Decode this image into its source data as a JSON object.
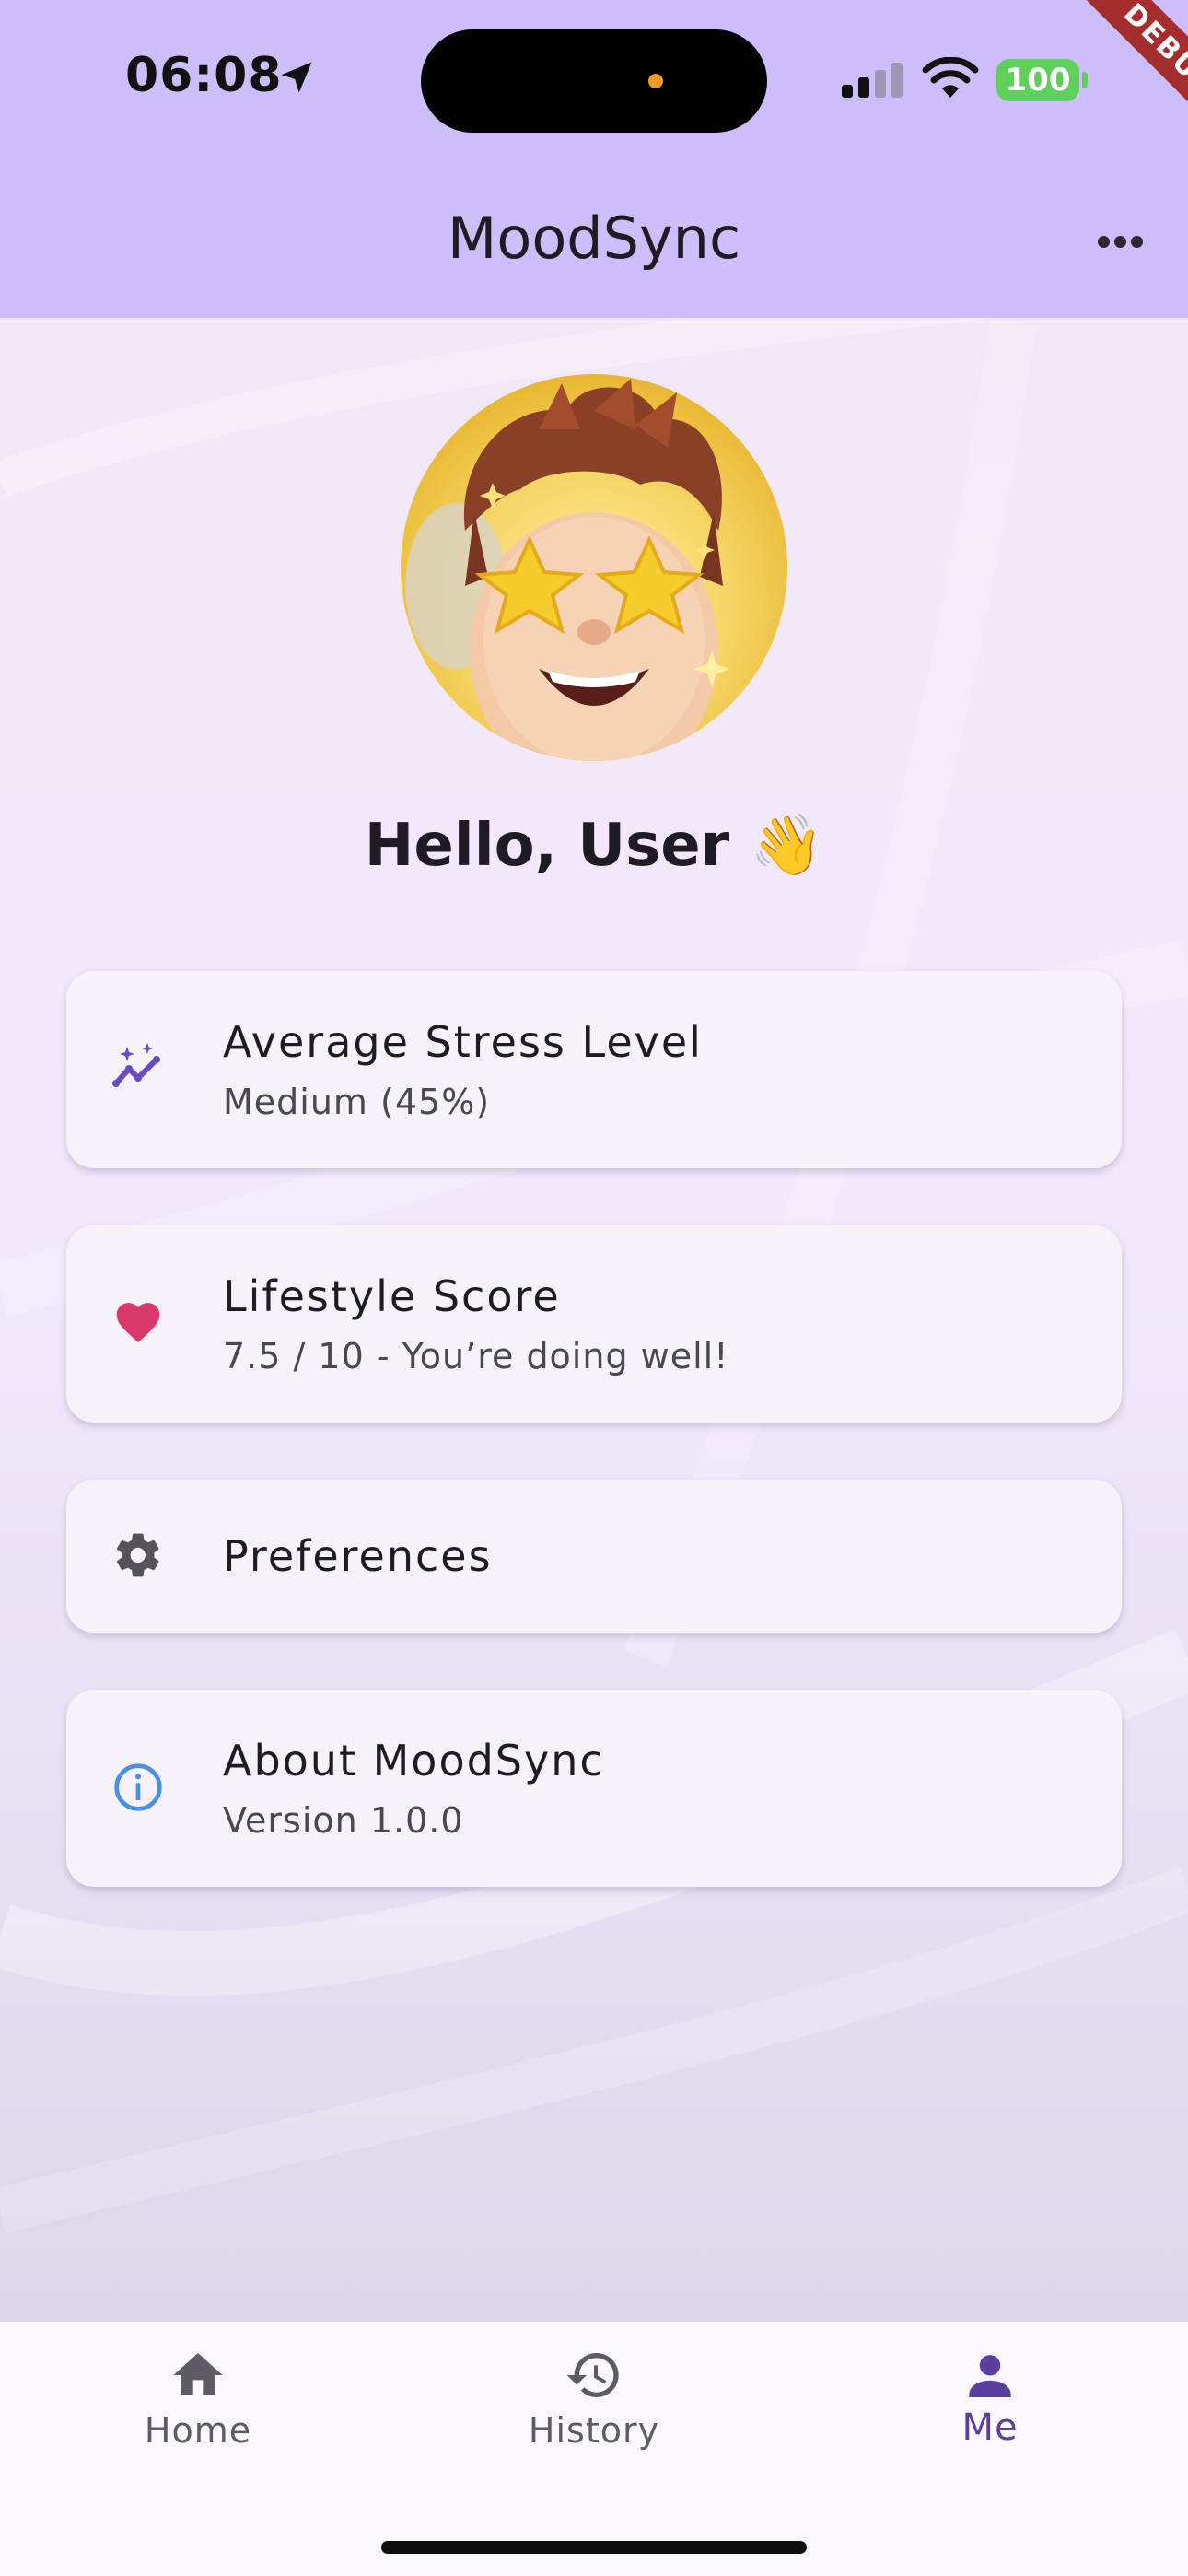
{
  "status_bar": {
    "time": "06:08",
    "battery": "100",
    "debug_label": "DEBUG"
  },
  "app_bar": {
    "title": "MoodSync"
  },
  "profile": {
    "greeting": "Hello, User 👋"
  },
  "cards": [
    {
      "title": "Average Stress Level",
      "subtitle": "Medium (45%)",
      "icon": "trending-sparkle-icon",
      "color": "#6a4bc4"
    },
    {
      "title": "Lifestyle Score",
      "subtitle": "7.5 / 10 - You’re doing well!",
      "icon": "heart-icon",
      "color": "#d8386a"
    },
    {
      "title": "Preferences",
      "icon": "gear-icon",
      "color": "#55525c"
    },
    {
      "title": "About MoodSync",
      "subtitle": "Version 1.0.0",
      "icon": "info-icon",
      "color": "#4a90e2"
    }
  ],
  "bottom_nav": {
    "items": [
      {
        "label": "Home",
        "icon": "home-icon"
      },
      {
        "label": "History",
        "icon": "history-icon"
      },
      {
        "label": "Me",
        "icon": "person-icon",
        "selected": true
      }
    ],
    "selected_color": "#5b3f9c"
  }
}
